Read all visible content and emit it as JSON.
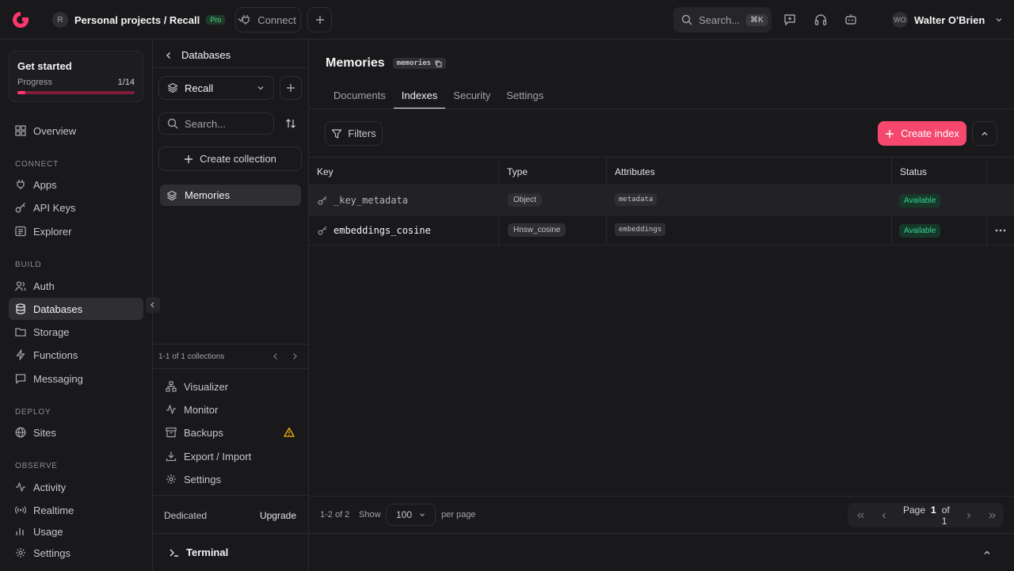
{
  "topbar": {
    "project_initial": "R",
    "project_title": "Personal projects / Recall",
    "plan_badge": "Pro",
    "connect_label": "Connect",
    "search_placeholder": "Search...",
    "search_shortcut": "⌘K",
    "user_initials": "WO",
    "user_name": "Walter O'Brien"
  },
  "get_started": {
    "title": "Get started",
    "progress_label": "Progress",
    "progress_count": "1/14",
    "progress_fraction": 0.07
  },
  "sidebar": {
    "overview": "Overview",
    "sections": {
      "connect": "CONNECT",
      "build": "BUILD",
      "deploy": "DEPLOY",
      "observe": "OBSERVE"
    },
    "items": {
      "apps": "Apps",
      "api_keys": "API Keys",
      "explorer": "Explorer",
      "auth": "Auth",
      "databases": "Databases",
      "storage": "Storage",
      "functions": "Functions",
      "messaging": "Messaging",
      "sites": "Sites",
      "activity": "Activity",
      "realtime": "Realtime",
      "usage": "Usage",
      "settings": "Settings"
    }
  },
  "panel": {
    "back_label": "Databases",
    "database_name": "Recall",
    "search_placeholder": "Search...",
    "create_collection": "Create collection",
    "collections": [
      "Memories"
    ],
    "pagination": "1-1 of 1 collections",
    "links": {
      "visualizer": "Visualizer",
      "monitor": "Monitor",
      "backups": "Backups",
      "export_import": "Export / Import",
      "settings": "Settings"
    },
    "plan_label": "Dedicated",
    "upgrade_label": "Upgrade"
  },
  "main": {
    "title": "Memories",
    "collection_id": "memories",
    "tabs": [
      "Documents",
      "Indexes",
      "Security",
      "Settings"
    ],
    "active_tab": "Indexes",
    "filters_label": "Filters",
    "create_index_label": "Create index",
    "columns": [
      "Key",
      "Type",
      "Attributes",
      "Status"
    ],
    "rows": [
      {
        "key": "_key_metadata",
        "type": "Object",
        "attributes": "metadata",
        "status": "Available"
      },
      {
        "key": "embeddings_cosine",
        "type": "Hnsw_cosine",
        "attributes": "embeddings",
        "status": "Available"
      }
    ],
    "pagination": {
      "range": "1-2 of 2",
      "show_label": "Show",
      "per_page_value": "100",
      "per_page_label": "per page",
      "page_label": "Page",
      "current_page": "1",
      "of_label": "of 1"
    }
  },
  "terminal": {
    "label": "Terminal"
  },
  "colors": {
    "accent": "#fd366e",
    "success": "#34d399",
    "warning": "#f5b400"
  }
}
